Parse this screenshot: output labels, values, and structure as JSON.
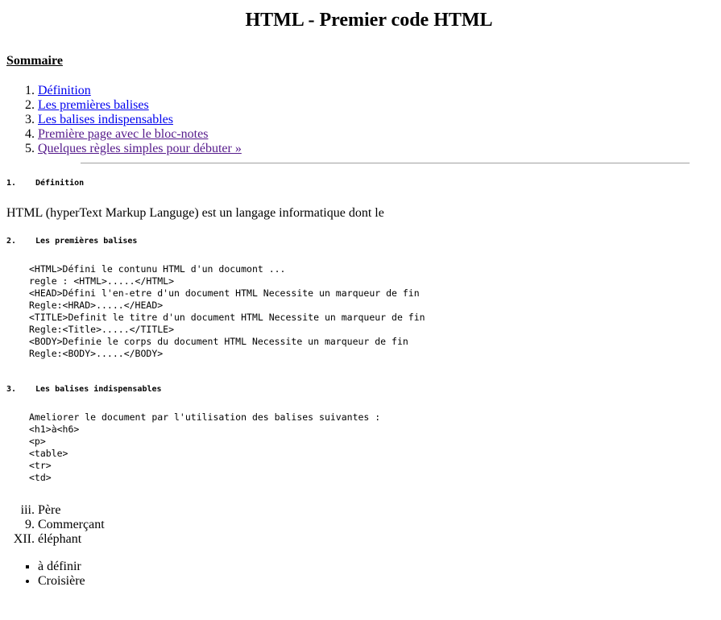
{
  "title": "HTML - Premier code HTML",
  "summary_heading": "Sommaire",
  "toc": [
    {
      "number": "1.",
      "label": "Définition",
      "visited": false
    },
    {
      "number": "2.",
      "label": "Les premières balises",
      "visited": false
    },
    {
      "number": "3.",
      "label": "Les balises indispensables",
      "visited": false
    },
    {
      "number": "4.",
      "label": "Première page avec le bloc-notes",
      "visited": true
    },
    {
      "number": "5.",
      "label": "Quelques règles simples pour débuter »",
      "visited": true
    }
  ],
  "sections": [
    {
      "number": "1.",
      "heading": "Définition",
      "paragraph": "HTML (hyperText Markup Languge) est un langage informatique dont le"
    },
    {
      "number": "2.",
      "heading": "Les premières balises",
      "code": [
        "<HTML>Défini le contunu HTML d'un documont ...",
        "regle : <HTML>.....</HTML>",
        "<HEAD>Défini l'en-etre d'un document HTML Necessite un marqueur de fin",
        "Regle:<HRAD>.....</HEAD>",
        "<TITLE>Definit le titre d'un document HTML Necessite un marqueur de fin",
        "Regle:<Title>.....</TITLE>",
        "<BODY>Definie le corps du document HTML Necessite un marqueur de fin",
        "Regle:<BODY>.....</BODY>"
      ]
    },
    {
      "number": "3.",
      "heading": "Les balises indispensables",
      "code": [
        "Ameliorer le document par l'utilisation des balises suivantes :",
        "<h1>à<h6>",
        "<p>",
        "<table>",
        "<tr>",
        "<td>"
      ]
    }
  ],
  "extra_list": [
    {
      "marker": "iii.",
      "label": "Père",
      "type": "i",
      "value": 3
    },
    {
      "marker": "9.",
      "label": "Commerçant",
      "type": "1",
      "value": 9
    },
    {
      "marker": "XII.",
      "label": "éléphant",
      "type": "I",
      "value": 12
    }
  ],
  "bullets": [
    {
      "label": "à définir",
      "style": "square"
    },
    {
      "label": "Croisière",
      "style": "disc"
    }
  ]
}
